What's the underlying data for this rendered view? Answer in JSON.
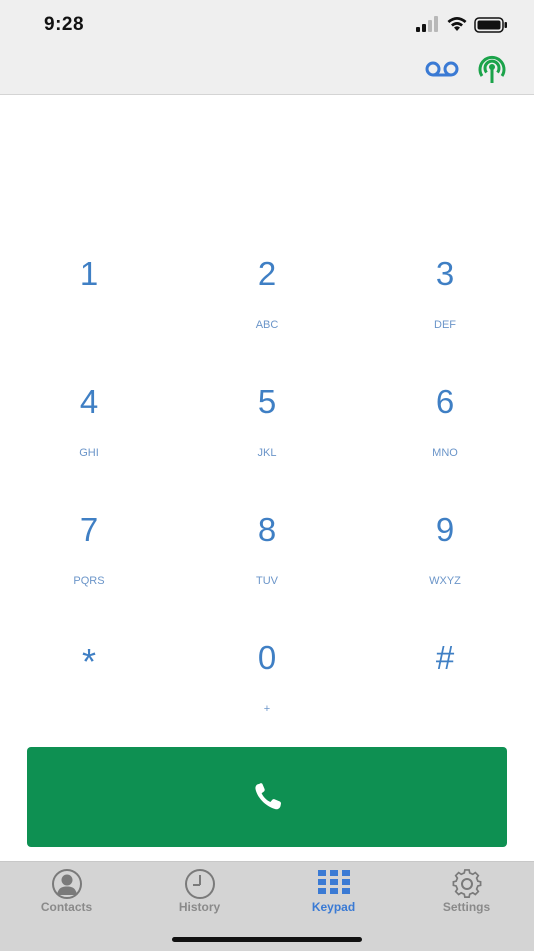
{
  "status_bar": {
    "time": "9:28",
    "icons": [
      "signal-icon",
      "wifi-icon",
      "battery-icon"
    ]
  },
  "header": {
    "buttons": [
      "voicemail-icon",
      "broadcast-icon"
    ],
    "colors": {
      "voicemail": "#3a7ad4",
      "broadcast": "#1ba34a"
    }
  },
  "keypad": {
    "keys": [
      {
        "digit": "1",
        "letters": ""
      },
      {
        "digit": "2",
        "letters": "ABC"
      },
      {
        "digit": "3",
        "letters": "DEF"
      },
      {
        "digit": "4",
        "letters": "GHI"
      },
      {
        "digit": "5",
        "letters": "JKL"
      },
      {
        "digit": "6",
        "letters": "MNO"
      },
      {
        "digit": "7",
        "letters": "PQRS"
      },
      {
        "digit": "8",
        "letters": "TUV"
      },
      {
        "digit": "9",
        "letters": "WXYZ"
      },
      {
        "digit": "*",
        "letters": ""
      },
      {
        "digit": "0",
        "letters": "+"
      },
      {
        "digit": "#",
        "letters": ""
      }
    ],
    "digit_color": "#3f7fc4"
  },
  "call_button": {
    "icon": "phone-icon",
    "color": "#0e9052"
  },
  "tabbar": {
    "tabs": [
      {
        "label": "Contacts",
        "icon": "contacts-icon",
        "active": false
      },
      {
        "label": "History",
        "icon": "history-icon",
        "active": false
      },
      {
        "label": "Keypad",
        "icon": "keypad-icon",
        "active": true
      },
      {
        "label": "Settings",
        "icon": "settings-icon",
        "active": false
      }
    ],
    "active_color": "#3a7ad4",
    "inactive_color": "#8a8a8a"
  }
}
